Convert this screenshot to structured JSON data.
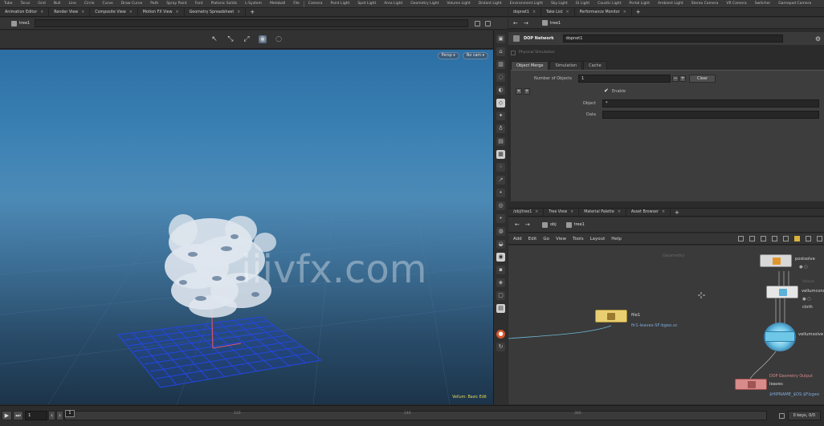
{
  "shelf": {
    "tools": [
      "Tube",
      "Torus",
      "Grid",
      "Null",
      "Line",
      "Circle",
      "Curve",
      "Draw Curve",
      "Path",
      "Spray Paint",
      "Font",
      "Platonic Solids",
      "L-System",
      "Metaball",
      "File"
    ],
    "lights": [
      "Camera",
      "Point Light",
      "Spot Light",
      "Area Light",
      "Geometry Light",
      "Volume Light",
      "Distant Light",
      "Environment Light",
      "Sky Light",
      "GI Light",
      "Caustic Light",
      "Portal Light",
      "Ambient Light",
      "Stereo Camera",
      "VR Camera",
      "Switcher",
      "Gamepad Camera"
    ]
  },
  "left_tabs": [
    {
      "label": "Animation Editor"
    },
    {
      "label": "Render View"
    },
    {
      "label": "Composite View"
    },
    {
      "label": "Motion FX View"
    },
    {
      "label": "Geometry Spreadsheet"
    }
  ],
  "left_path": {
    "node": "tree1"
  },
  "viewport": {
    "camera_menu": "Persp ▾",
    "cam_menu": "No cam ▾",
    "mode_note": "Vellum: Basic Edit",
    "watermark": "iiivfx.com"
  },
  "right_tabs": [
    {
      "label": "dopnet1"
    },
    {
      "label": "Take List"
    },
    {
      "label": "Performance Monitor"
    }
  ],
  "right_path": {
    "node": "tree1"
  },
  "param_header": {
    "type": "DOP Network",
    "name": "dopnet1"
  },
  "physical_sim": {
    "label": "Physical Simulation"
  },
  "param_tabs": [
    {
      "label": "Object Merge"
    },
    {
      "label": "Simulation"
    },
    {
      "label": "Cache"
    }
  ],
  "params": {
    "num_objects_label": "Number of Objects",
    "num_objects_value": "1",
    "clear_label": "Clear",
    "enable_label": "Enable",
    "object_label": "Object",
    "object_value": "*",
    "data_label": "Data",
    "data_value": ""
  },
  "net_tabs": [
    {
      "label": "/obj/tree1"
    },
    {
      "label": "Tree View"
    },
    {
      "label": "Material Palette"
    },
    {
      "label": "Asset Browser"
    }
  ],
  "net_path": {
    "obj": "obj",
    "node": "tree1"
  },
  "net_menu": [
    "Add",
    "Edit",
    "Go",
    "View",
    "Tools",
    "Layout",
    "Help"
  ],
  "network": {
    "context_label": "Geometry",
    "nodes": {
      "file1": {
        "name": "file1",
        "detail": "fir1-leaves-SF-bgeo.sc"
      },
      "postsolve": {
        "name": "postsolve",
        "flags": "● ○"
      },
      "vellumconstraints": {
        "name": "vellumcons",
        "sub": "cloth",
        "flags": "● ○",
        "title": "Vellum"
      },
      "vellumsolver": {
        "name": "vellumsolve"
      },
      "leaves": {
        "title": "DOP Geometry Output",
        "name": "leaves",
        "detail": "$HIPNAME_$OS.$F.bgeo"
      }
    }
  },
  "timeline": {
    "current_frame": "1",
    "cursor": "1",
    "ticks": [
      "120",
      "240",
      "360"
    ],
    "keys_label": "0 keys, 0/0"
  },
  "colors": {
    "viewport_top": "#2b6fa5",
    "viewport_bottom": "#1c344a",
    "grid": "#1f3fd4",
    "file_node": "#e9cf72",
    "solver_node": "#6fc7e8",
    "output_node": "#d98a8a",
    "accent_orange": "#d8542b"
  }
}
